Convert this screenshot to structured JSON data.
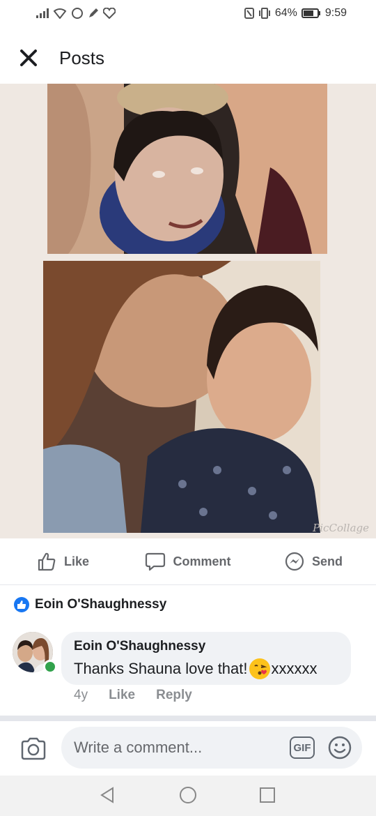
{
  "status_bar": {
    "battery_percent": "64%",
    "time": "9:59"
  },
  "header": {
    "title": "Posts"
  },
  "collage": {
    "watermark": "PicCollage"
  },
  "actions": {
    "like_label": "Like",
    "comment_label": "Comment",
    "send_label": "Send"
  },
  "reaction": {
    "name": "Eoin O'Shaughnessy"
  },
  "comment": {
    "author": "Eoin O'Shaughnessy",
    "text_before_emoji": "Thanks Shauna love that!",
    "text_after_emoji": " xxxxxx",
    "age": "4y",
    "like_label": "Like",
    "reply_label": "Reply"
  },
  "composer": {
    "placeholder": "Write a comment...",
    "gif_label": "GIF"
  },
  "colors": {
    "accent": "#1877f2",
    "online": "#31a24c",
    "bubble": "#f0f2f5"
  }
}
